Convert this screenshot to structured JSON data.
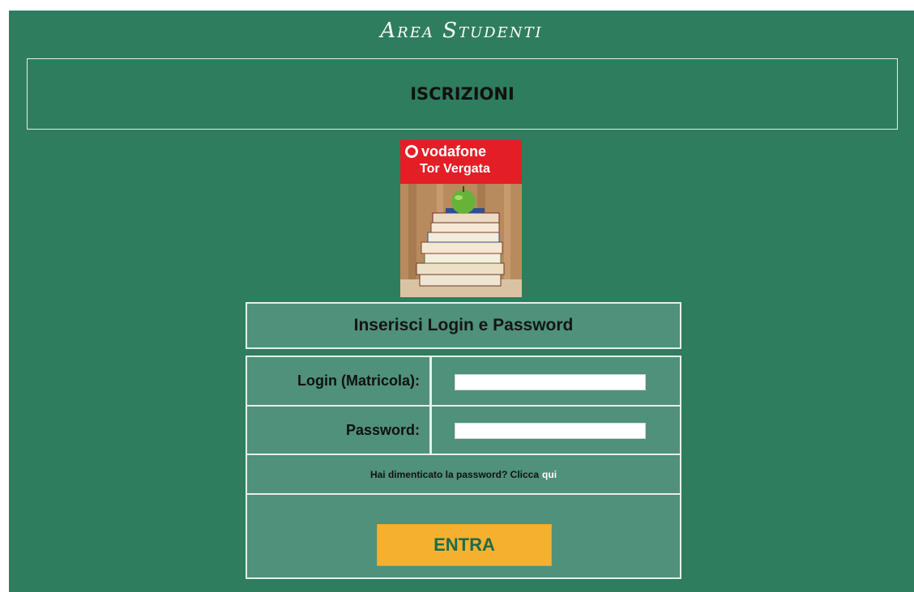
{
  "header": {
    "title": "Area Studenti"
  },
  "section": {
    "title": "ISCRIZIONI"
  },
  "promo": {
    "brand": "vodafone",
    "subtitle": "Tor Vergata"
  },
  "login": {
    "heading": "Inserisci Login e Password",
    "login_label": "Login (Matricola):",
    "login_value": "",
    "password_label": "Password:",
    "password_value": "",
    "forgot_text": "Hai dimenticato la password? Clicca",
    "forgot_link": "qui",
    "submit_label": "ENTRA"
  },
  "colors": {
    "background": "#2e7d5e",
    "panel": "#4f917a",
    "button": "#f5b12e",
    "button_text": "#1f6b4b",
    "promo_red": "#e41e26"
  }
}
